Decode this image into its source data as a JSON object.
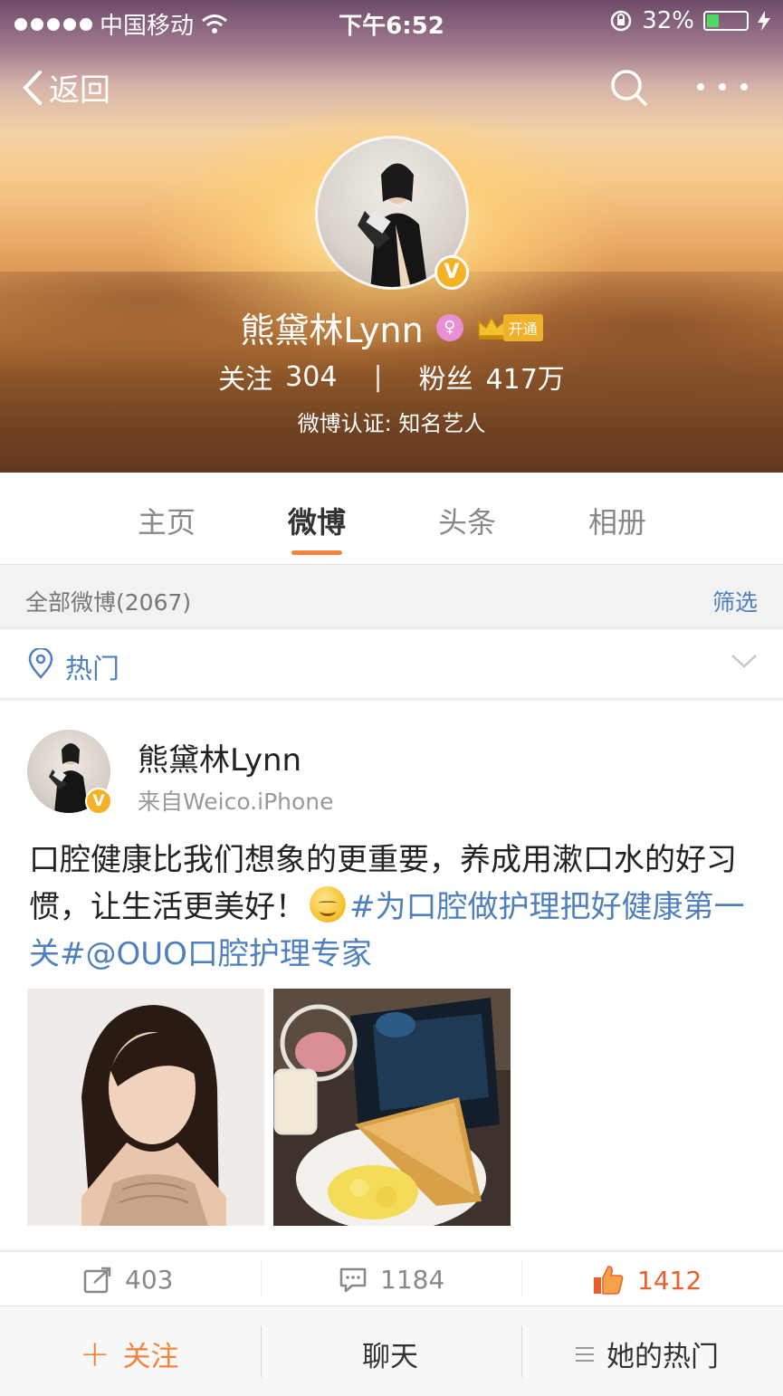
{
  "status_bar": {
    "carrier": "中国移动",
    "time": "下午6:52",
    "battery_percent": "32%",
    "battery_level": 0.32
  },
  "nav": {
    "back_label": "返回"
  },
  "profile": {
    "name": "熊黛林Lynn",
    "vip_label": "开通",
    "following_label": "关注",
    "following_count": "304",
    "followers_label": "粉丝",
    "followers_count": "417万",
    "verification": "微博认证: 知名艺人",
    "verified_badge": "V"
  },
  "tabs": [
    {
      "label": "主页",
      "active": false
    },
    {
      "label": "微博",
      "active": true
    },
    {
      "label": "头条",
      "active": false
    },
    {
      "label": "相册",
      "active": false
    }
  ],
  "filter_bar": {
    "all_posts": "全部微博(2067)",
    "filter_label": "筛选"
  },
  "hot_bar": {
    "label": "热门"
  },
  "post": {
    "author": "熊黛林Lynn",
    "source": "来自Weico.iPhone",
    "text_plain": "口腔健康比我们想象的更重要，养成用漱口水的好习惯，让生活更美好！",
    "hashtag": "#为口腔做护理把好健康第一关#",
    "mention": "@OUO口腔护理专家",
    "reposts": "403",
    "comments": "1184",
    "likes": "1412"
  },
  "bottom_bar": {
    "follow_label": "关注",
    "chat_label": "聊天",
    "hot_label": "她的热门"
  },
  "colors": {
    "accent_orange": "#f5833b",
    "link_blue": "#4f7fbf",
    "like_red": "#e8612c",
    "verified_gold": "#f5b226"
  }
}
